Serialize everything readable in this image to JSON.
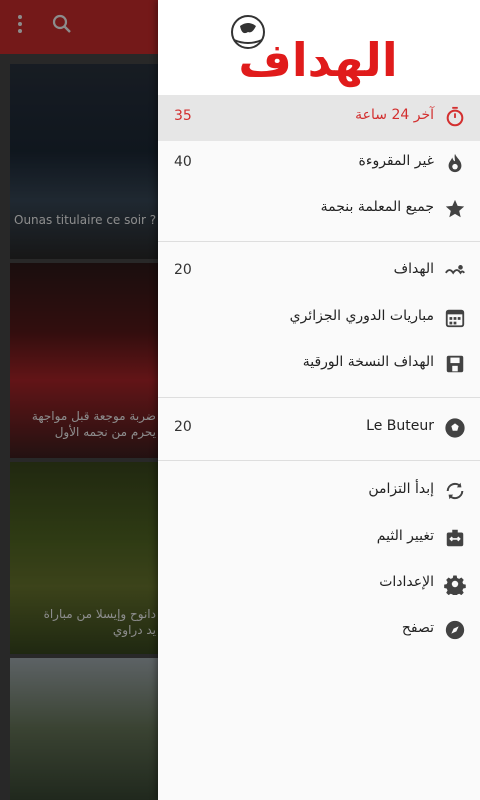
{
  "background_articles": [
    {
      "caption": "Ounas titulaire ce soir ?"
    },
    {
      "caption_lines": [
        "ضربة موجعة قبل مواجهة",
        "يحرم من نجمه الأول"
      ]
    },
    {
      "caption_lines": [
        "دانوح وإيسلا من مباراة",
        "يد دراوي"
      ]
    },
    {
      "caption": ""
    }
  ],
  "drawer": {
    "logo_text": "الهداف",
    "sections": [
      {
        "items": [
          {
            "id": "last24",
            "label": "آخر 24 ساعة",
            "count": "35",
            "icon": "timer-icon",
            "active": true
          },
          {
            "id": "unread",
            "label": "غير المقروءة",
            "count": "40",
            "icon": "flame-icon"
          },
          {
            "id": "starred",
            "label": "جميع المعلمة بنجمة",
            "count": "",
            "icon": "star-icon"
          }
        ]
      },
      {
        "items": [
          {
            "id": "elheddaf",
            "label": "الهداف",
            "count": "20",
            "icon": "elheddaf-logo-icon"
          },
          {
            "id": "matches",
            "label": "مباريات الدوري الجزائري",
            "count": "",
            "icon": "calendar-icon"
          },
          {
            "id": "paper",
            "label": "الهداف النسخة الورقية",
            "count": "",
            "icon": "save-icon"
          }
        ]
      },
      {
        "items": [
          {
            "id": "lebuteur",
            "label": "Le Buteur",
            "count": "20",
            "icon": "soccer-ball-icon"
          }
        ]
      },
      {
        "items": [
          {
            "id": "sync",
            "label": "إبدأ التزامن",
            "count": "",
            "icon": "sync-icon"
          },
          {
            "id": "theme",
            "label": "تغيير الثيم",
            "count": "",
            "icon": "theme-icon"
          },
          {
            "id": "settings",
            "label": "الإعدادات",
            "count": "",
            "icon": "gear-icon"
          },
          {
            "id": "browse",
            "label": "تصفح",
            "count": "",
            "icon": "compass-icon"
          }
        ]
      }
    ]
  },
  "colors": {
    "accent": "#d32f2f",
    "toolbar": "#d32f2f"
  }
}
